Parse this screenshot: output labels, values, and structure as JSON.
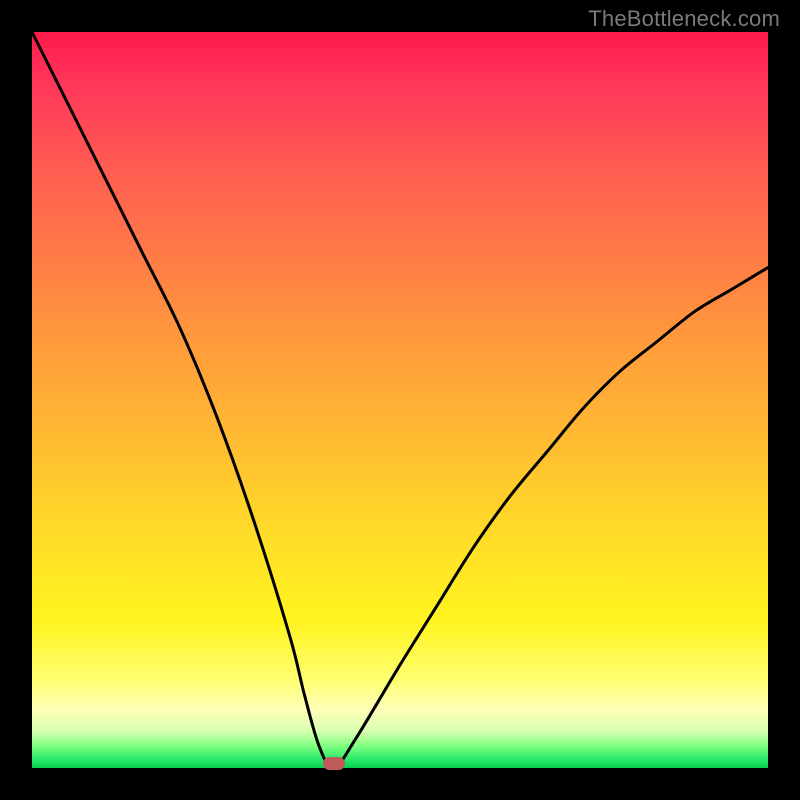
{
  "watermark": "TheBottleneck.com",
  "chart_data": {
    "type": "line",
    "title": "",
    "xlabel": "",
    "ylabel": "",
    "xlim": [
      0,
      100
    ],
    "ylim": [
      0,
      100
    ],
    "grid": false,
    "legend": false,
    "series": [
      {
        "name": "bottleneck-curve",
        "x": [
          0,
          5,
          10,
          15,
          20,
          25,
          30,
          35,
          37,
          39,
          41,
          44,
          50,
          55,
          60,
          65,
          70,
          75,
          80,
          85,
          90,
          95,
          100
        ],
        "values": [
          100,
          90,
          80,
          70,
          60,
          48,
          34,
          18,
          10,
          3,
          0,
          4,
          14,
          22,
          30,
          37,
          43,
          49,
          54,
          58,
          62,
          65,
          68
        ]
      }
    ],
    "optimum_marker": {
      "x": 41,
      "y": 0
    },
    "background_gradient": {
      "top": "#ff1a4d",
      "mid": "#ffdb28",
      "bottom": "#0acc4e"
    }
  }
}
